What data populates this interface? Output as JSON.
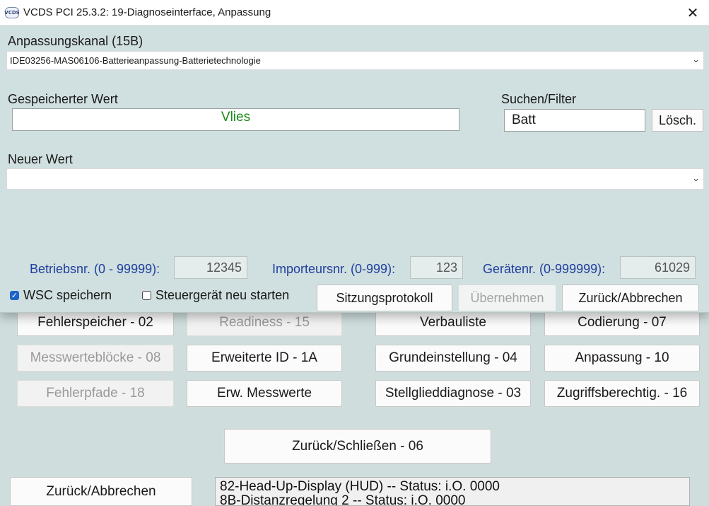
{
  "window": {
    "title": "VCDS PCI 25.3.2: 19-Diagnoseinterface,  Anpassung",
    "icon": "vcds-app-icon",
    "icon_text": "VCDS",
    "close_glyph": "✕"
  },
  "adaptation_channel": {
    "label": "Anpassungskanal (15B)",
    "selected": "IDE03256-MAS06106-Batterieanpassung-Batterietechnologie"
  },
  "stored_value": {
    "label": "Gespeicherter Wert",
    "value": "Vlies",
    "value_color": "#1a8a1a"
  },
  "search": {
    "label": "Suchen/Filter",
    "value": "Batt",
    "clear_button": "Lösch."
  },
  "new_value": {
    "label": "Neuer Wert",
    "selected": ""
  },
  "codes": {
    "betriebsnr_label": "Betriebsnr. (0 - 99999):",
    "betriebsnr_value": "12345",
    "importeursnr_label": "Importeursnr. (0-999):",
    "importeursnr_value": "123",
    "geraetenr_label": "Gerätenr. (0-999999):",
    "geraetenr_value": "61029"
  },
  "options": {
    "wsc_label": "WSC speichern",
    "wsc_checked": true,
    "restart_label": "Steuergerät neu starten",
    "restart_checked": false
  },
  "dialog_buttons": {
    "session_log": "Sitzungsprotokoll",
    "apply": "Übernehmen",
    "back_cancel": "Zurück/Abbrechen"
  },
  "background": {
    "buttons": {
      "fault_memory": "Fehlerspeicher - 02",
      "readiness": "Readiness - 15",
      "verbauliste": "Verbauliste",
      "coding": "Codierung - 07",
      "measuring_blocks": "Messwerteblöcke - 08",
      "extended_id": "Erweiterte ID - 1A",
      "basic_settings": "Grundeinstellung - 04",
      "adaptation": "Anpassung - 10",
      "fault_paths": "Fehlerpfade - 18",
      "ext_measurements": "Erw. Messwerte",
      "actuator_test": "Stellglieddiagnose - 03",
      "access_auth": "Zugriffsberechtig. - 16",
      "back_close": "Zurück/Schließen - 06",
      "back_cancel": "Zurück/Abbrechen"
    },
    "status_lines": [
      "82-Head-Up-Display (HUD) -- Status: i.O. 0000",
      "8B-Distanzregelung 2 -- Status: i.O. 0000"
    ]
  },
  "colors": {
    "dialog_bg": "#d0dfdf",
    "label_blue": "#1f3fa0",
    "checkbox_blue": "#1e64c8"
  }
}
